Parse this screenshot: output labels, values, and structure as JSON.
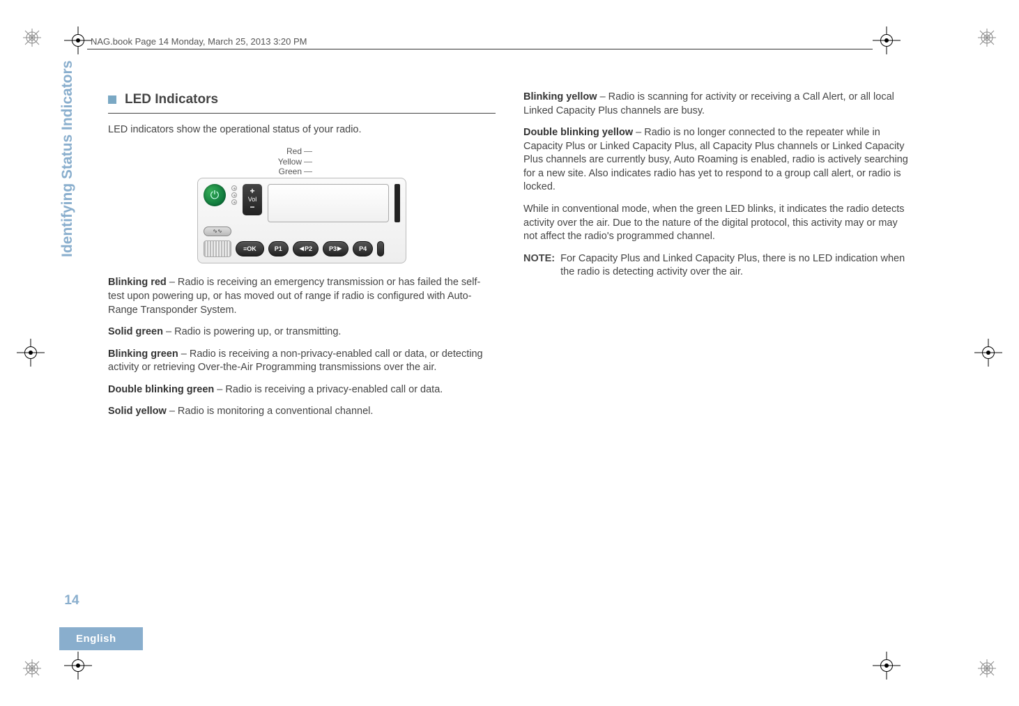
{
  "header_runner": "NAG.book  Page 14  Monday, March 25, 2013  3:20 PM",
  "side_chapter": "Identifying Status Indicators",
  "page_number": "14",
  "language_tab": "English",
  "section": {
    "title": "LED Indicators",
    "intro": "LED indicators show the operational status of your radio."
  },
  "led_labels": {
    "red": "Red",
    "yellow": "Yellow",
    "green": "Green"
  },
  "radio": {
    "vol_label": "Vol",
    "ok_label": "OK",
    "p1": "P1",
    "p2": "P2",
    "p3": "P3",
    "p4": "P4"
  },
  "defs": {
    "blinking_red": {
      "term": "Blinking red",
      "dash": " – ",
      "body": "Radio is receiving an emergency transmission or has failed the self-test upon powering up, or has moved out of range if radio is configured with Auto-Range Transponder System."
    },
    "solid_green": {
      "term": "Solid green",
      "dash": " – ",
      "body": "Radio is powering up, or transmitting."
    },
    "blinking_green": {
      "term": "Blinking green",
      "dash": " – ",
      "body": "Radio is receiving a non-privacy-enabled call or data, or detecting activity or retrieving Over-the-Air Programming transmissions over the air."
    },
    "dbl_blinking_green": {
      "term": "Double blinking green",
      "dash": " – ",
      "body": "Radio is receiving a privacy-enabled call or data."
    },
    "solid_yellow": {
      "term": "Solid yellow",
      "dash": " – ",
      "body": "Radio is monitoring a conventional channel."
    },
    "blinking_yellow": {
      "term": "Blinking yellow",
      "dash": " – ",
      "body": "Radio is scanning for activity or receiving a Call Alert, or all local Linked Capacity Plus channels are busy."
    },
    "dbl_blinking_yellow": {
      "term": "Double blinking yellow",
      "dash": " – ",
      "body": "Radio is no longer connected to the repeater while in Capacity Plus or Linked Capacity Plus, all Capacity Plus channels or Linked Capacity Plus channels are currently busy, Auto Roaming is enabled, radio is actively searching for a new site. Also indicates radio has yet to respond to a group call alert, or radio is locked."
    }
  },
  "paragraphs": {
    "conventional": "While in conventional mode, when the green LED blinks, it indicates the radio detects activity over the air. Due to the nature of the digital protocol, this activity may or may not affect the radio's programmed channel."
  },
  "note": {
    "label": "NOTE:",
    "body": "For Capacity Plus and Linked Capacity Plus, there is no LED indication when the radio is detecting activity over the air."
  }
}
